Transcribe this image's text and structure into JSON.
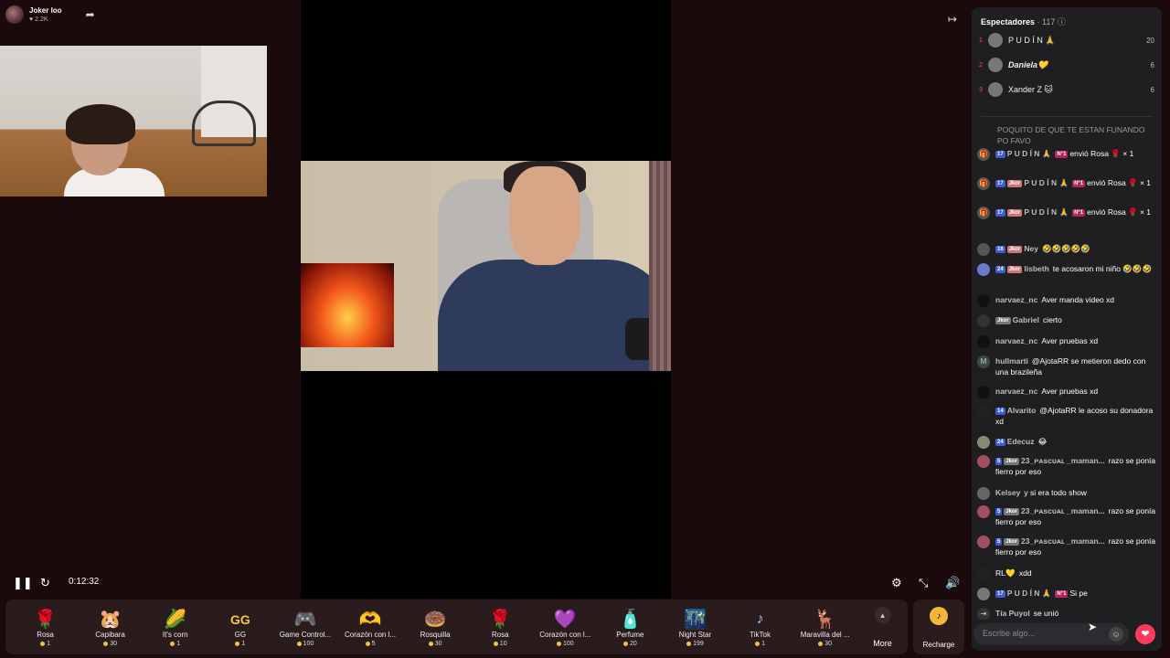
{
  "host": {
    "name": "Joker loo",
    "likes": "♥ 2.2K"
  },
  "player": {
    "time": "0:12:32"
  },
  "viewers": {
    "title": "Espectadores",
    "count": "· 117"
  },
  "top_viewers": [
    {
      "rank": "1",
      "name": "P U D Í N 🙏",
      "score": "20"
    },
    {
      "rank": "2",
      "name": "Daniela💛",
      "score": "6"
    },
    {
      "rank": "3",
      "name": "Xander Z 🐱",
      "score": "6"
    }
  ],
  "chat": {
    "faded": "POQUITO DE QUE TE ESTAN FUNANDO PO FAVO",
    "messages": [
      {
        "user": "P U D Í N 🙏",
        "text": "envió Rosa 🌹 × 1",
        "lv": "17",
        "jk": "",
        "n1": "N°1"
      },
      {
        "user": "P U D Í N 🙏",
        "text": "envió Rosa 🌹 × 1",
        "lv": "17",
        "jk": "Jkor",
        "n1": "N°1"
      },
      {
        "user": "P U D Í N 🙏",
        "text": "envió Rosa 🌹 × 1",
        "lv": "17",
        "jk": "Jkor",
        "n1": "N°1"
      },
      {
        "user": "Ney",
        "text": "🤣🤣🤣🤣🤣",
        "lv": "16",
        "jk": "Jkor",
        "n1": ""
      },
      {
        "user": "lisbeth",
        "text": "te acosaron mi niño 🤣🤣🤣",
        "lv": "24",
        "jk": "Jkor",
        "n1": ""
      },
      {
        "user": "narvaez_nc",
        "text": "Aver manda video xd",
        "lv": "",
        "jk": "",
        "n1": ""
      },
      {
        "user": "Gabriel",
        "text": "cierto",
        "lv": "",
        "jk": "Jkor",
        "n1": ""
      },
      {
        "user": "narvaez_nc",
        "text": "Aver pruebas xd",
        "lv": "",
        "jk": "",
        "n1": ""
      },
      {
        "user": "hullmarti",
        "text": "@AjotaRR se metieron dedo con una brazileña",
        "lv": "",
        "jk": "",
        "n1": ""
      },
      {
        "user": "narvaez_nc",
        "text": "Aver pruebas xd",
        "lv": "",
        "jk": "",
        "n1": ""
      },
      {
        "user": "Alvarito",
        "text": "@AjotaRR le acoso su donadora xd",
        "lv": "14",
        "jk": "",
        "n1": ""
      },
      {
        "user": "Edecuz",
        "text": "😂",
        "lv": "24",
        "jk": "",
        "n1": ""
      },
      {
        "user": "23_ᴘᴀsᴄᴜᴀʟ _maman...",
        "text": "razo se ponía fierro por eso",
        "lv": "5",
        "jk": "Jkor",
        "n1": ""
      },
      {
        "user": "Kelsey",
        "text": "y si era todo show",
        "lv": "",
        "jk": "",
        "n1": ""
      },
      {
        "user": "23_ᴘᴀsᴄᴜᴀʟ _maman...",
        "text": "razo se ponía fierro por eso",
        "lv": "5",
        "jk": "Jkor",
        "n1": ""
      },
      {
        "user": "23_ᴘᴀsᴄᴜᴀʟ _maman...",
        "text": "razo se ponía fierro por eso",
        "lv": "5",
        "jk": "Jkor",
        "n1": ""
      },
      {
        "user": "RL💛",
        "text": "xdd",
        "lv": "",
        "jk": "",
        "n1": ""
      },
      {
        "user": "P U D Í N 🙏",
        "text": "Si pe",
        "lv": "17",
        "jk": "",
        "n1": "N°1"
      },
      {
        "user": "Tía Puyol",
        "text": "se unió",
        "lv": "",
        "jk": "",
        "n1": ""
      }
    ]
  },
  "gifts": [
    {
      "icon": "🌹",
      "name": "Rosa",
      "price": "1"
    },
    {
      "icon": "🐹",
      "name": "Capibara",
      "price": "30"
    },
    {
      "icon": "🌽",
      "name": "It's corn",
      "price": "1"
    },
    {
      "icon": "GG",
      "name": "GG",
      "price": "1"
    },
    {
      "icon": "🎮",
      "name": "Game Control...",
      "price": "100"
    },
    {
      "icon": "🫶",
      "name": "Corazón con l...",
      "price": "5"
    },
    {
      "icon": "🍩",
      "name": "Rosquilla",
      "price": "30"
    },
    {
      "icon": "🌹",
      "name": "Rosa",
      "price": "10"
    },
    {
      "icon": "💜",
      "name": "Corazón con l...",
      "price": "100"
    },
    {
      "icon": "🧴",
      "name": "Perfume",
      "price": "20"
    },
    {
      "icon": "🌃",
      "name": "Night Star",
      "price": "199"
    },
    {
      "icon": "♪",
      "name": "TikTok",
      "price": "1"
    },
    {
      "icon": "🦌",
      "name": "Maravilla del ...",
      "price": "30"
    }
  ],
  "gift_more_label": "More",
  "recharge_label": "Recharge",
  "chat_input": {
    "placeholder": "Escribe algo..."
  },
  "colors": {
    "accent": "#ff3b5c",
    "level_badge": "#3d5ad8",
    "coin": "#f4c33a"
  }
}
